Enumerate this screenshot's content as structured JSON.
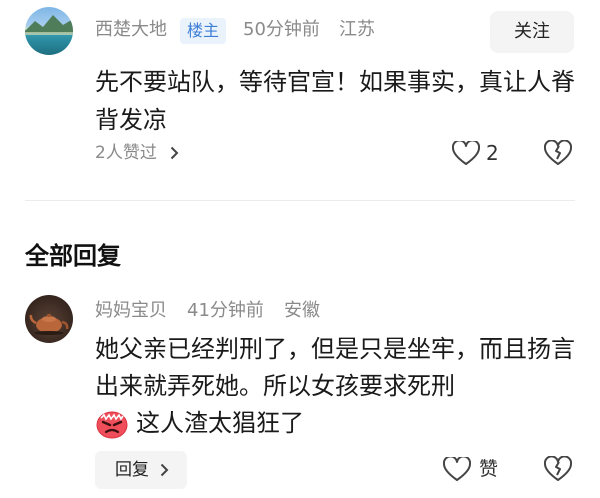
{
  "post": {
    "username": "西楚大地",
    "badge": "楼主",
    "time": "50分钟前",
    "location": "江苏",
    "follow_label": "关注",
    "text": "先不要站队，等待官宣！如果事实，真让人脊背发凉",
    "likers_text": "2人赞过",
    "like_count": "2",
    "icons": [
      "heart-icon",
      "dislike-icon",
      "chevron-right-icon"
    ]
  },
  "section": {
    "title": "全部回复"
  },
  "reply": {
    "username": "妈妈宝贝",
    "time": "41分钟前",
    "location": "安徽",
    "text": "她父亲已经判刑了，但是只是坐牢，而且扬言出来就弄死她。所以女孩要求死刑",
    "line3_text": "这人渣太猖狂了",
    "emoji": "angry-face-emoji",
    "reply_label": "回复",
    "like_label": "赞"
  },
  "colors": {
    "badge_text": "#3d7fd6",
    "badge_bg": "#eaf2fc",
    "meta_gray": "#8a8a8a",
    "button_bg": "#f4f4f4"
  }
}
